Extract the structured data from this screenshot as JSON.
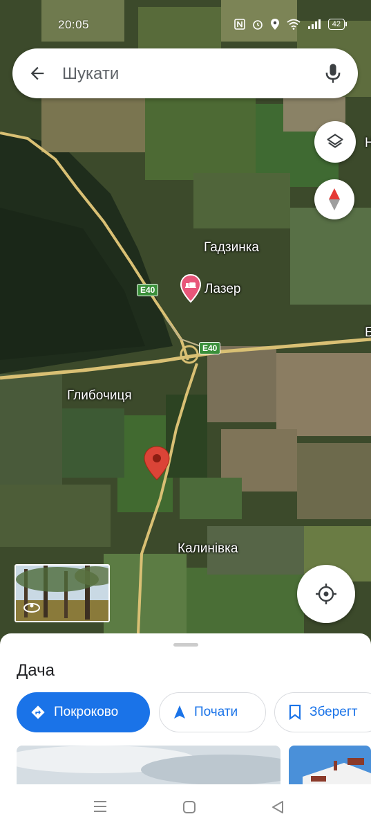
{
  "status_bar": {
    "time": "20:05",
    "battery": "42",
    "icons": [
      "nfc-icon",
      "alarm-icon",
      "location-icon",
      "wifi-icon",
      "signal-icon",
      "battery-icon"
    ]
  },
  "search": {
    "placeholder": "Шукати"
  },
  "map": {
    "labels": {
      "hadzynka": "Гадзинка",
      "lazer": "Лазер",
      "hlybochytsia": "Глибочиця",
      "kalynivka": "Калинівка",
      "edge_h": "Н",
      "edge_b": "Б"
    },
    "road_shields": {
      "e40_west": "E40",
      "e40_east": "E40"
    },
    "pin_color": "#db4437",
    "poi_color": "#e8567a"
  },
  "sheet": {
    "title": "Дача",
    "buttons": {
      "directions": "Покроково",
      "start": "Почати",
      "save": "Зберегт"
    },
    "accent": "#1a73e8"
  },
  "navbar": {
    "icons": [
      "menu-icon",
      "home-icon",
      "back-icon"
    ]
  }
}
